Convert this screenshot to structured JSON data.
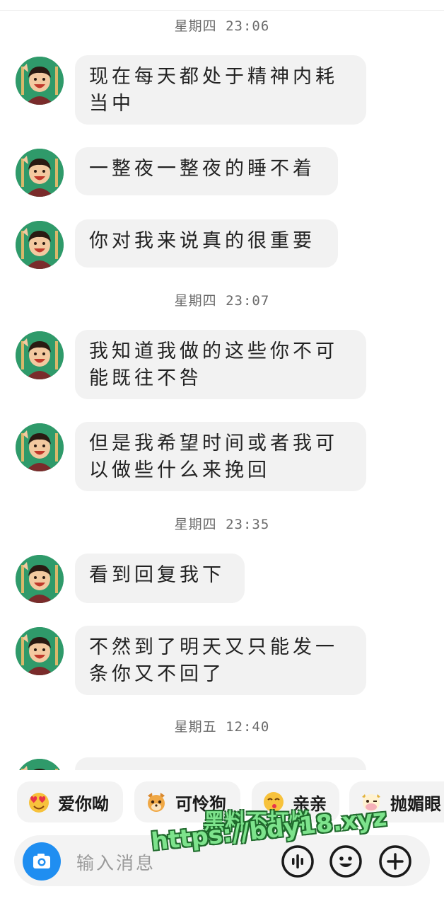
{
  "messages_area": {
    "groups": [
      {
        "timestamp": "星期四 23:06",
        "messages": [
          {
            "lines": [
              "现在每天都处于精神内耗",
              "当中"
            ]
          },
          {
            "lines": [
              "一整夜一整夜的睡不着"
            ]
          },
          {
            "lines": [
              "你对我来说真的很重要"
            ]
          }
        ]
      },
      {
        "timestamp": "星期四 23:07",
        "messages": [
          {
            "lines": [
              "我知道我做的这些你不可",
              "能既往不咎"
            ]
          },
          {
            "lines": [
              "但是我希望时间或者我可",
              "以做些什么来挽回"
            ]
          }
        ]
      },
      {
        "timestamp": "星期四 23:35",
        "messages": [
          {
            "lines": [
              "看到回复我下"
            ]
          },
          {
            "lines": [
              "不然到了明天又只能发一",
              "条你又不回了"
            ]
          }
        ]
      },
      {
        "timestamp": "星期五 12:40",
        "messages": []
      }
    ]
  },
  "quick_replies": [
    {
      "label": "爱你呦",
      "icon": "heart-eyes-emoji-icon"
    },
    {
      "label": "可怜狗",
      "icon": "pitiful-dog-emoji-icon"
    },
    {
      "label": "亲亲",
      "icon": "kiss-emoji-icon"
    },
    {
      "label": "抛媚眼",
      "icon": "wink-cow-emoji-icon"
    }
  ],
  "composer": {
    "placeholder": "输入消息",
    "camera_icon": "camera-icon",
    "voice_icon": "voice-wave-icon",
    "emoji_icon": "smiley-icon",
    "plus_icon": "plus-icon"
  },
  "watermark": {
    "line1": "黑料不打烊",
    "line2": "https://bdy18.xyz"
  },
  "colors": {
    "bubble": "#f2f2f2",
    "camera_button": "#1f8ef1",
    "watermark_fill": "#7de38c",
    "watermark_outline": "#1f6a2c"
  }
}
